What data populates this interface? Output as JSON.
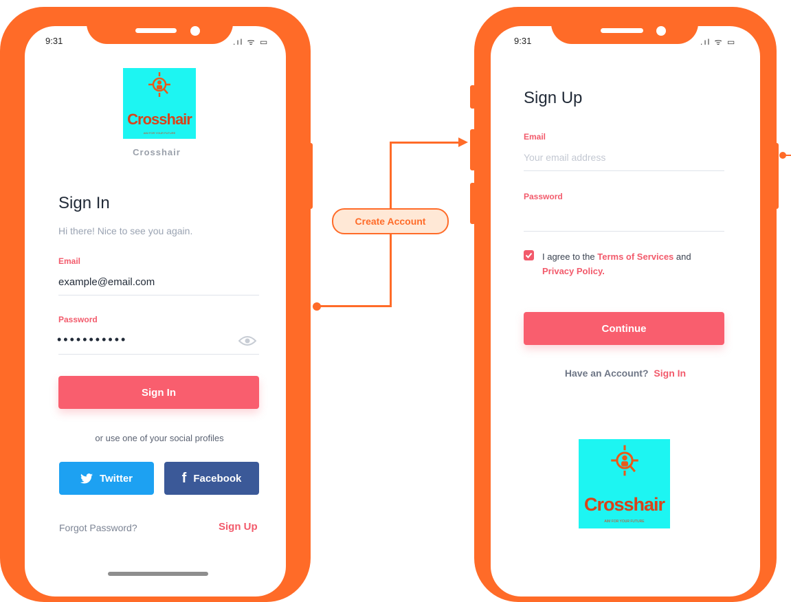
{
  "status_time": "9:31",
  "status_icons": ".ıl ᯤ ▭",
  "colors": {
    "frame": "#ff6b28",
    "accent": "#f95e6e",
    "twitter": "#1da1f2",
    "facebook": "#3b5998",
    "logo_bg": "#1df5f2"
  },
  "logo": {
    "brand": "Crosshair",
    "tagline": "AIM FOR YOUR FUTURE",
    "icon": "crosshair-person-icon"
  },
  "signin": {
    "logo_caption": "Crosshair",
    "title": "Sign In",
    "subtitle": "Hi there! Nice to see you again.",
    "email_label": "Email",
    "email_value": "example@email.com",
    "password_label": "Password",
    "password_value": "•••••••••••",
    "button": "Sign In",
    "social_prompt": "or use one of your social profiles",
    "twitter": "Twitter",
    "facebook": "Facebook",
    "forgot": "Forgot Password?",
    "signup_link": "Sign Up"
  },
  "flow": {
    "label": "Create Account"
  },
  "signup": {
    "title": "Sign Up",
    "email_label": "Email",
    "email_placeholder": "Your email address",
    "password_label": "Password",
    "agree_prefix": "I agree to the",
    "terms": "Terms of Services",
    "agree_and": "and",
    "privacy": "Privacy Policy.",
    "button": "Continue",
    "have_account": "Have an Account?",
    "signin_link": "Sign In"
  }
}
